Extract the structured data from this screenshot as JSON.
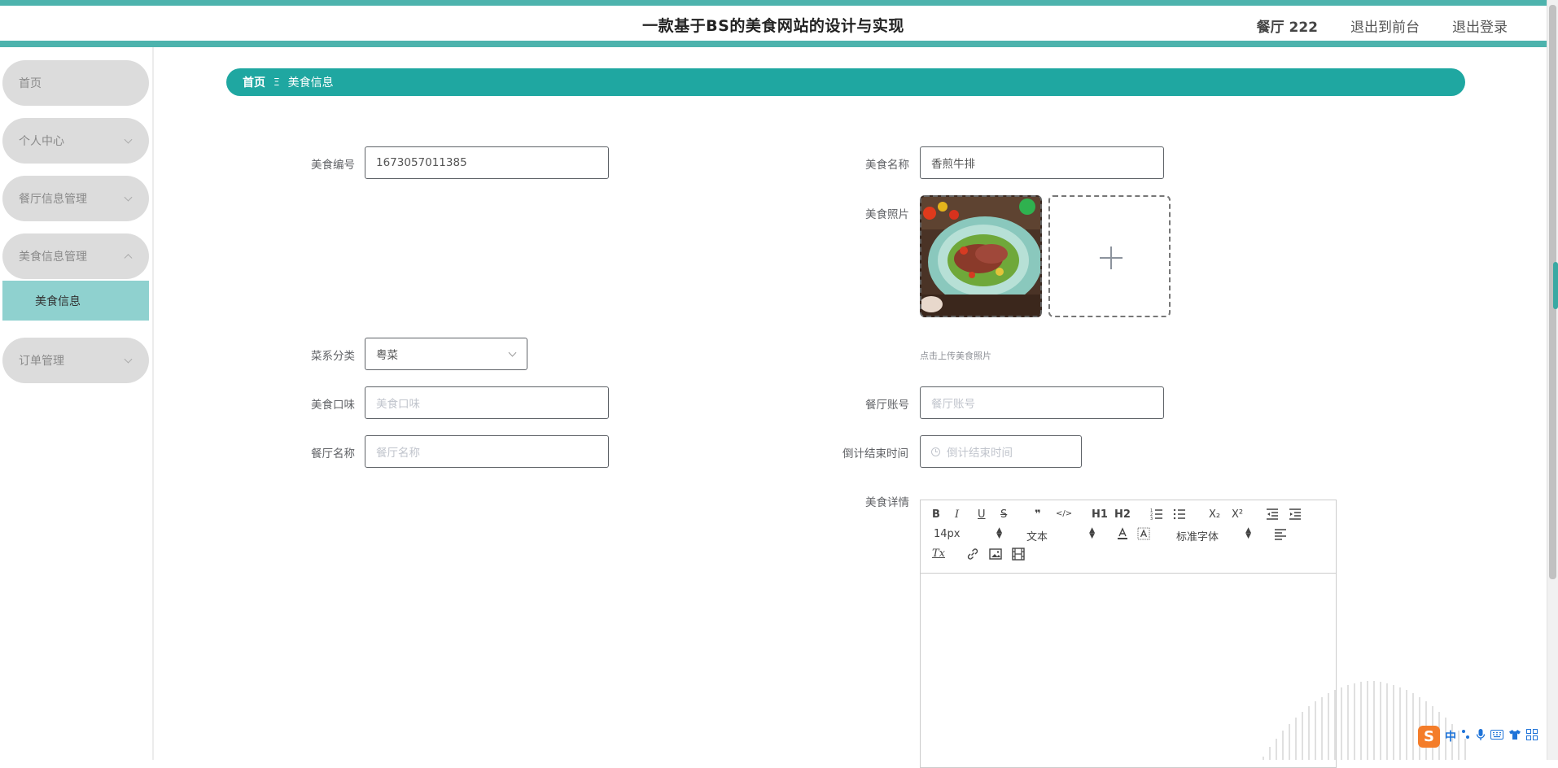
{
  "header": {
    "title": "一款基于BS的美食网站的设计与实现",
    "user": "餐厅 222",
    "back_to_front": "退出到前台",
    "logout": "退出登录"
  },
  "sidebar": {
    "items": [
      {
        "label": "首页"
      },
      {
        "label": "个人中心"
      },
      {
        "label": "餐厅信息管理"
      },
      {
        "label": "美食信息管理"
      },
      {
        "label": "美食信息"
      },
      {
        "label": "订单管理"
      }
    ]
  },
  "breadcrumb": {
    "home": "首页",
    "separator": "Ξ",
    "current": "美食信息"
  },
  "form": {
    "food_id": {
      "label": "美食编号",
      "value": "1673057011385"
    },
    "food_name": {
      "label": "美食名称",
      "value": "香煎牛排"
    },
    "photo": {
      "label": "美食照片",
      "hint": "点击上传美食照片"
    },
    "cuisine": {
      "label": "菜系分类",
      "value": "粤菜"
    },
    "taste": {
      "label": "美食口味",
      "placeholder": "美食口味"
    },
    "restaurant_account": {
      "label": "餐厅账号",
      "placeholder": "餐厅账号"
    },
    "restaurant_name": {
      "label": "餐厅名称",
      "placeholder": "餐厅名称"
    },
    "countdown": {
      "label": "倒计结束时间",
      "placeholder": "倒计结束时间"
    },
    "details": {
      "label": "美食详情"
    }
  },
  "editor": {
    "bold": "B",
    "italic": "I",
    "underline": "U",
    "strike": "S",
    "quote": "❞",
    "code": "</>",
    "h1": "H1",
    "h2": "H2",
    "subscript": "X₂",
    "superscript": "X²",
    "size": "14px",
    "style": "文本",
    "font": "标准字体",
    "clear_format": "Tx"
  },
  "ime": {
    "logo": "S",
    "mode": "中"
  },
  "colors": {
    "accent": "#1fa7a1",
    "header_line": "#4db3ad",
    "submenu_active": "#8fd1cf",
    "menu_bg": "#dcdcdc"
  }
}
